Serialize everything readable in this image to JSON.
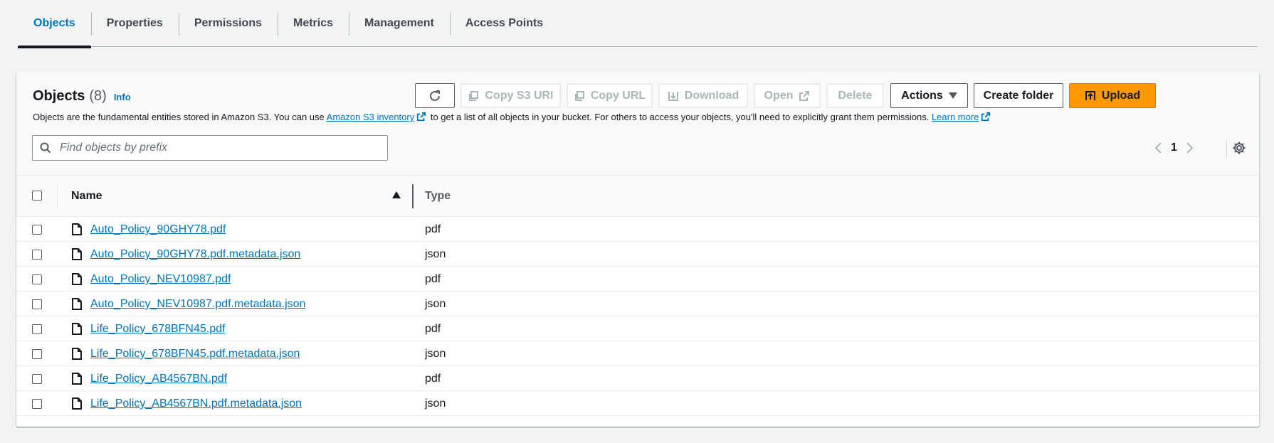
{
  "tabs": [
    {
      "label": "Objects",
      "active": true
    },
    {
      "label": "Properties"
    },
    {
      "label": "Permissions"
    },
    {
      "label": "Metrics"
    },
    {
      "label": "Management"
    },
    {
      "label": "Access Points"
    }
  ],
  "header": {
    "title": "Objects",
    "count": "(8)",
    "info": "Info",
    "desc_1": "Objects are the fundamental entities stored in Amazon S3. You can use ",
    "desc_link_1": "Amazon S3 inventory",
    "desc_2": " to get a list of all objects in your bucket. For others to access your objects, you'll need to explicitly grant them permissions. ",
    "desc_link_2": "Learn more"
  },
  "toolbar": {
    "refresh_icon": "refresh-icon",
    "copy_s3_uri": "Copy S3 URI",
    "copy_url": "Copy URL",
    "download": "Download",
    "open": "Open",
    "delete": "Delete",
    "actions": "Actions",
    "create_folder": "Create folder",
    "upload": "Upload"
  },
  "search": {
    "placeholder": "Find objects by prefix",
    "value": ""
  },
  "pagination": {
    "current_page": "1"
  },
  "table": {
    "columns": {
      "name": "Name",
      "type": "Type"
    },
    "rows": [
      {
        "name": "Auto_Policy_90GHY78.pdf",
        "type": "pdf"
      },
      {
        "name": "Auto_Policy_90GHY78.pdf.metadata.json",
        "type": "json"
      },
      {
        "name": "Auto_Policy_NEV10987.pdf",
        "type": "pdf"
      },
      {
        "name": "Auto_Policy_NEV10987.pdf.metadata.json",
        "type": "json"
      },
      {
        "name": "Life_Policy_678BFN45.pdf",
        "type": "pdf"
      },
      {
        "name": "Life_Policy_678BFN45.pdf.metadata.json",
        "type": "json"
      },
      {
        "name": "Life_Policy_AB4567BN.pdf",
        "type": "pdf"
      },
      {
        "name": "Life_Policy_AB4567BN.pdf.metadata.json",
        "type": "json"
      }
    ]
  },
  "colors": {
    "accent": "#0073bb",
    "primary": "#ff9900",
    "text": "#16191f",
    "disabled": "#aab7b8"
  }
}
